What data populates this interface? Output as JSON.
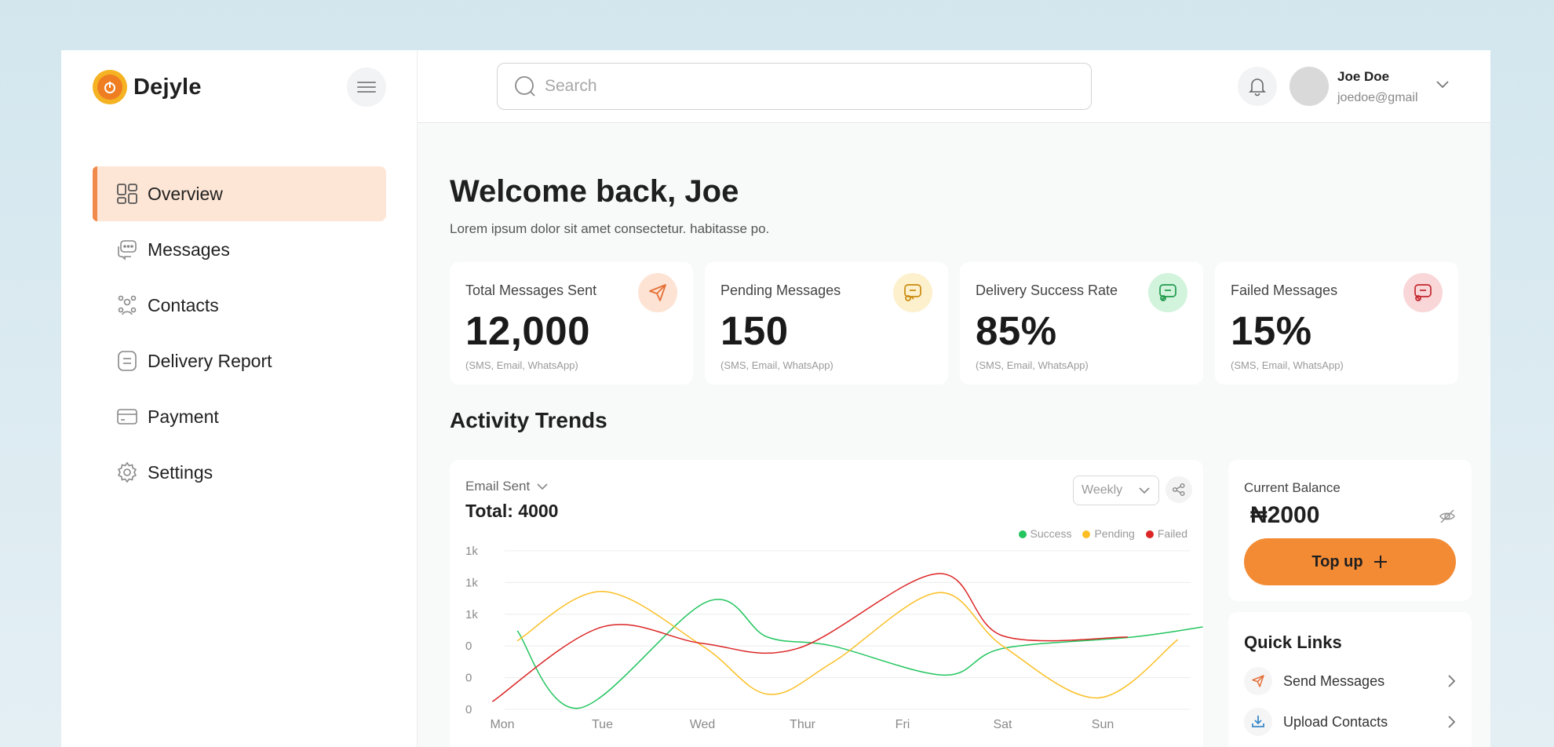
{
  "app": {
    "name": "Dejyle"
  },
  "colors": {
    "accent": "#F38B35",
    "success": "#22C55E",
    "pending": "#FBBF24",
    "failed": "#DC2626"
  },
  "sidebar": {
    "items": [
      {
        "label": "Overview",
        "icon": "grid-icon",
        "active": true
      },
      {
        "label": "Messages",
        "icon": "chat-icon",
        "active": false
      },
      {
        "label": "Contacts",
        "icon": "contacts-icon",
        "active": false
      },
      {
        "label": "Delivery Report",
        "icon": "report-icon",
        "active": false
      },
      {
        "label": "Payment",
        "icon": "card-icon",
        "active": false
      },
      {
        "label": "Settings",
        "icon": "gear-icon",
        "active": false
      }
    ]
  },
  "topbar": {
    "search_placeholder": "Search",
    "user": {
      "name": "Joe Doe",
      "email": "joedoe@gmail"
    }
  },
  "main": {
    "welcome": "Welcome back, Joe",
    "subtitle": "Lorem ipsum dolor sit amet consectetur. habitasse po.",
    "stats": [
      {
        "label": "Total Messages Sent",
        "value": "12,000",
        "note": "(SMS, Email, WhatsApp)",
        "icon": "send-icon"
      },
      {
        "label": "Pending Messages",
        "value": "150",
        "note": "(SMS, Email, WhatsApp)",
        "icon": "pending-chat-icon"
      },
      {
        "label": "Delivery Success Rate",
        "value": "85%",
        "note": "(SMS, Email, WhatsApp)",
        "icon": "success-chat-icon"
      },
      {
        "label": "Failed Messages",
        "value": "15%",
        "note": "(SMS, Email, WhatsApp)",
        "icon": "failed-chat-icon"
      }
    ],
    "activity_title": "Activity Trends",
    "chart": {
      "selector": "Email Sent",
      "total": "Total: 4000",
      "period": "Weekly"
    },
    "balance": {
      "label": "Current Balance",
      "value": "₦2000",
      "topup_label": "Top up"
    },
    "quick_links": {
      "title": "Quick Links",
      "items": [
        {
          "label": "Send Messages",
          "icon": "send-icon"
        },
        {
          "label": "Upload Contacts",
          "icon": "upload-icon"
        }
      ]
    }
  },
  "chart_data": {
    "type": "line",
    "title": "",
    "xlabel": "",
    "ylabel": "",
    "categories": [
      "Mon",
      "Tue",
      "Wed",
      "Thur",
      "Fri",
      "Sat",
      "Sun"
    ],
    "y_tick_labels": [
      "1k",
      "1k",
      "1k",
      "0",
      "0",
      "0"
    ],
    "ylim": [
      0,
      1250
    ],
    "grid": true,
    "legend_position": "top-right",
    "series": [
      {
        "name": "Success",
        "color": "#22C55E",
        "x": [
          0.15,
          0.77,
          2.05,
          2.65,
          3.3,
          4.42,
          5.0,
          6.3,
          7.0
        ],
        "values": [
          620,
          10,
          850,
          570,
          500,
          270,
          480,
          570,
          650
        ]
      },
      {
        "name": "Pending",
        "color": "#FBBF24",
        "x": [
          0.15,
          1.0,
          2.0,
          2.65,
          3.3,
          4.35,
          5.0,
          5.95,
          6.75
        ],
        "values": [
          540,
          930,
          500,
          120,
          370,
          920,
          500,
          90,
          550
        ]
      },
      {
        "name": "Failed",
        "color": "#DC2626",
        "x": [
          -0.1,
          1.0,
          2.0,
          2.95,
          4.35,
          5.0,
          6.25
        ],
        "values": [
          60,
          650,
          520,
          480,
          1070,
          580,
          570
        ]
      }
    ]
  }
}
